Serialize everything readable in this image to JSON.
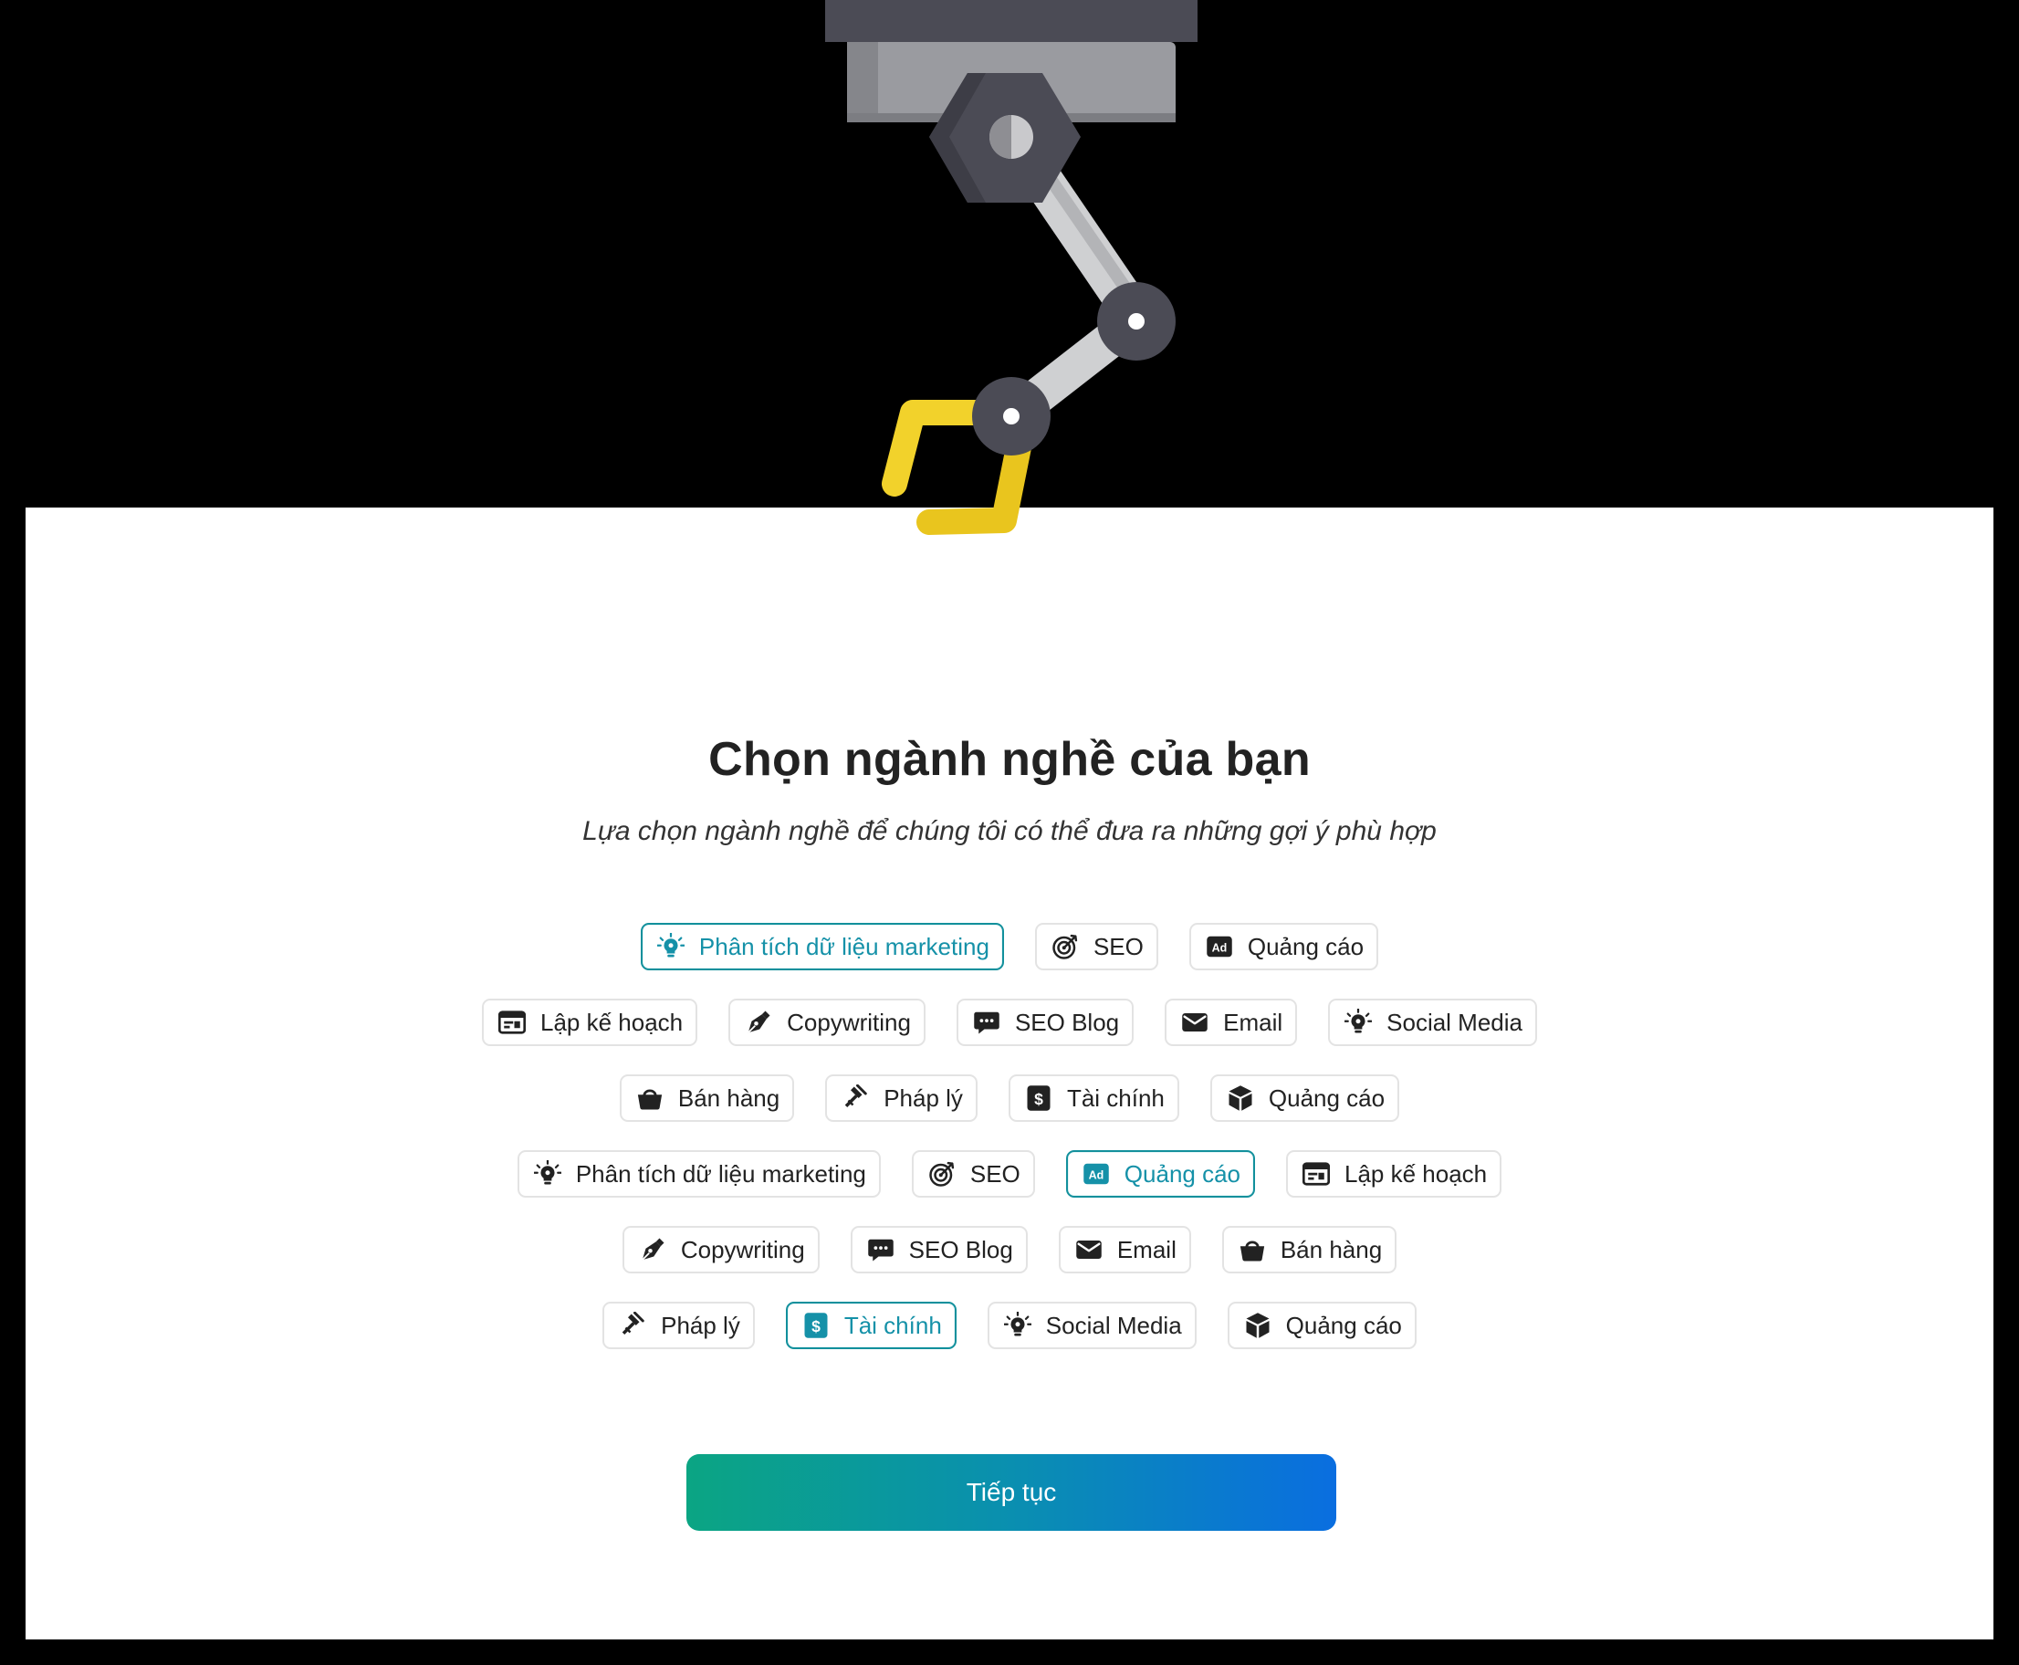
{
  "page": {
    "title": "Chọn ngành nghề của bạn",
    "subtitle": "Lựa chọn ngành nghề để chúng tôi có thể đưa ra những gợi ý phù hợp"
  },
  "colors": {
    "accent": "#1591a8",
    "button_gradient_start": "#0ba583",
    "button_gradient_end": "#0a6ee0"
  },
  "rows": [
    [
      {
        "label": "Phân tích dữ liệu marketing",
        "icon": "bulb-icon",
        "selected": true
      },
      {
        "label": "SEO",
        "icon": "target-icon",
        "selected": false
      },
      {
        "label": "Quảng cáo",
        "icon": "ad-icon",
        "selected": false
      }
    ],
    [
      {
        "label": "Lập kế hoạch",
        "icon": "planner-icon",
        "selected": false
      },
      {
        "label": "Copywriting",
        "icon": "pen-icon",
        "selected": false
      },
      {
        "label": "SEO Blog",
        "icon": "chat-icon",
        "selected": false
      },
      {
        "label": "Email",
        "icon": "mail-icon",
        "selected": false
      },
      {
        "label": "Social Media",
        "icon": "bulb-icon",
        "selected": false
      }
    ],
    [
      {
        "label": "Bán hàng",
        "icon": "basket-icon",
        "selected": false
      },
      {
        "label": "Pháp lý",
        "icon": "gavel-icon",
        "selected": false
      },
      {
        "label": "Tài chính",
        "icon": "dollar-icon",
        "selected": false
      },
      {
        "label": "Quảng cáo",
        "icon": "box-icon",
        "selected": false
      }
    ],
    [
      {
        "label": "Phân tích dữ liệu marketing",
        "icon": "bulb-icon",
        "selected": false
      },
      {
        "label": "SEO",
        "icon": "target-icon",
        "selected": false
      },
      {
        "label": "Quảng cáo",
        "icon": "ad-icon",
        "selected": true
      },
      {
        "label": "Lập kế hoạch",
        "icon": "planner-icon",
        "selected": false
      }
    ],
    [
      {
        "label": "Copywriting",
        "icon": "pen-icon",
        "selected": false
      },
      {
        "label": "SEO Blog",
        "icon": "chat-icon",
        "selected": false
      },
      {
        "label": "Email",
        "icon": "mail-icon",
        "selected": false
      },
      {
        "label": "Bán hàng",
        "icon": "basket-icon",
        "selected": false
      }
    ],
    [
      {
        "label": "Pháp lý",
        "icon": "gavel-icon",
        "selected": false
      },
      {
        "label": "Tài chính",
        "icon": "dollar-icon",
        "selected": true
      },
      {
        "label": "Social Media",
        "icon": "bulb-icon",
        "selected": false
      },
      {
        "label": "Quảng cáo",
        "icon": "box-icon",
        "selected": false
      }
    ]
  ],
  "continue_button": {
    "label": "Tiếp tục"
  }
}
